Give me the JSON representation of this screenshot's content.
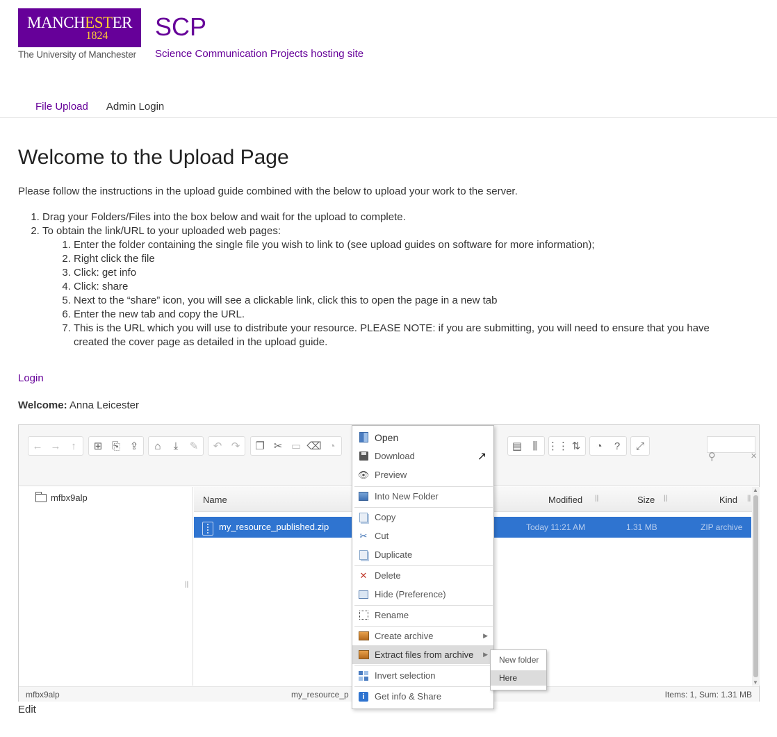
{
  "header": {
    "logo_name_left": "MANCH",
    "logo_name_gold": "EST",
    "logo_name_right": "ER",
    "logo_year": "1824",
    "logo_subtitle": "The University of Manchester",
    "site_title": "SCP",
    "site_subtitle": "Science Communication Projects hosting site",
    "brand_color": "#660099"
  },
  "nav": {
    "items": [
      {
        "label": "File Upload"
      },
      {
        "label": "Admin Login"
      }
    ]
  },
  "content": {
    "title": "Welcome to the Upload Page",
    "intro": "Please follow the instructions in the upload guide combined with the below to upload your work to the server.",
    "steps": [
      "Drag your Folders/Files into the box below and wait for the upload to complete.",
      "To obtain the link/URL to your uploaded web pages:"
    ],
    "substeps": [
      "Enter the folder containing the single file you wish to link to (see upload guides on software for more information);",
      "Right click the file",
      "Click: get info",
      "Click: share",
      "Next to the “share” icon, you will see a clickable link, click this to open the page in a new tab",
      "Enter the new tab and copy the URL.",
      "This is the URL which you will use to distribute your resource. PLEASE NOTE: if you are submitting, you will need to ensure that you have created the cover page as detailed in the upload guide."
    ],
    "login_link": "Login",
    "welcome_label": "Welcome:",
    "welcome_user": "Anna Leicester",
    "edit_link": "Edit"
  },
  "file_manager": {
    "tree_folder": "mfbx9alp",
    "columns": {
      "name": "Name",
      "modified": "Modified",
      "size": "Size",
      "kind": "Kind"
    },
    "file": {
      "name": "my_resource_published.zip",
      "modified": "Today 11:21 AM",
      "size": "1.31 MB",
      "kind": "ZIP archive"
    },
    "status": {
      "path": "mfbx9alp",
      "selected": "my_resource_p",
      "summary": "Items: 1, Sum: 1.31 MB"
    },
    "selection_color": "#2f74d0"
  },
  "context_menu": {
    "items": [
      {
        "label": "Open",
        "icon": "open-icon"
      },
      {
        "label": "Download",
        "icon": "download-icon"
      },
      {
        "label": "Preview",
        "icon": "eye-icon"
      },
      {
        "label": "Into New Folder",
        "icon": "new-folder-icon"
      },
      {
        "label": "Copy",
        "icon": "copy-icon"
      },
      {
        "label": "Cut",
        "icon": "scissors-icon"
      },
      {
        "label": "Duplicate",
        "icon": "duplicate-icon"
      },
      {
        "label": "Delete",
        "icon": "delete-icon"
      },
      {
        "label": "Hide (Preference)",
        "icon": "hide-icon"
      },
      {
        "label": "Rename",
        "icon": "rename-icon"
      },
      {
        "label": "Create archive",
        "icon": "archive-icon"
      },
      {
        "label": "Extract files from archive",
        "icon": "extract-icon"
      },
      {
        "label": "Invert selection",
        "icon": "invert-icon"
      },
      {
        "label": "Get info & Share",
        "icon": "info-icon"
      }
    ],
    "submenu": [
      {
        "label": "New folder"
      },
      {
        "label": "Here"
      }
    ]
  }
}
